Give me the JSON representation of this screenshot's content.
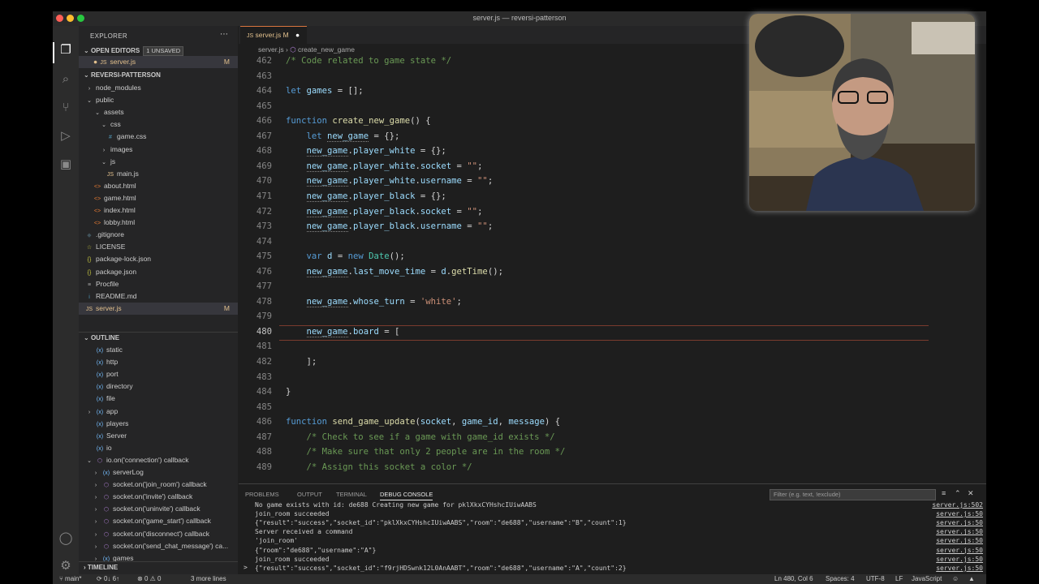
{
  "window_title": "server.js — reversi-patterson",
  "explorer": {
    "title": "EXPLORER",
    "open_editors_label": "OPEN EDITORS",
    "unsaved_badge": "1 UNSAVED",
    "open_file": "server.js",
    "open_file_status": "M",
    "project": "REVERSI-PATTERSON",
    "tree": [
      {
        "name": "node_modules",
        "type": "folder-closed"
      },
      {
        "name": "public",
        "type": "folder-open"
      },
      {
        "name": "assets",
        "type": "folder-open"
      },
      {
        "name": "css",
        "type": "folder-open"
      },
      {
        "name": "game.css",
        "type": "css"
      },
      {
        "name": "images",
        "type": "folder-closed"
      },
      {
        "name": "js",
        "type": "folder-open"
      },
      {
        "name": "main.js",
        "type": "js"
      },
      {
        "name": "about.html",
        "type": "html"
      },
      {
        "name": "game.html",
        "type": "html"
      },
      {
        "name": "index.html",
        "type": "html"
      },
      {
        "name": "lobby.html",
        "type": "html"
      },
      {
        "name": ".gitignore",
        "type": "git"
      },
      {
        "name": "LICENSE",
        "type": "license"
      },
      {
        "name": "package-lock.json",
        "type": "json"
      },
      {
        "name": "package.json",
        "type": "json"
      },
      {
        "name": "Procfile",
        "type": "file"
      },
      {
        "name": "README.md",
        "type": "md"
      },
      {
        "name": "server.js",
        "type": "js",
        "status": "M"
      }
    ]
  },
  "outline": {
    "title": "OUTLINE",
    "items": [
      "static",
      "http",
      "port",
      "directory",
      "file",
      "app",
      "players",
      "Server",
      "io",
      "io.on('connection') callback",
      "serverLog",
      "socket.on('join_room') callback",
      "socket.on('invite') callback",
      "socket.on('uninvite') callback",
      "socket.on('game_start') callback",
      "socket.on('disconnect') callback",
      "socket.on('send_chat_message') ca...",
      "games"
    ],
    "timeline_label": "TIMELINE"
  },
  "editor": {
    "tab_label": "server.js",
    "tab_status": "M",
    "breadcrumb_file": "server.js",
    "breadcrumb_symbol": "create_new_game",
    "current_line": "480",
    "lines": [
      {
        "n": "462",
        "html": "<span class='com'>/* Code related to game state */</span>"
      },
      {
        "n": "463",
        "html": ""
      },
      {
        "n": "464",
        "html": "<span class='kw'>let</span> <span class='var'>games</span> = [];"
      },
      {
        "n": "465",
        "html": ""
      },
      {
        "n": "466",
        "html": "<span class='kw'>function</span> <span class='fn'>create_new_game</span>() {"
      },
      {
        "n": "467",
        "html": "    <span class='kw'>let</span> <span class='var u'>new_game</span> = {};"
      },
      {
        "n": "468",
        "html": "    <span class='var u'>new_game</span>.<span class='var'>player_white</span> = {};"
      },
      {
        "n": "469",
        "html": "    <span class='var u'>new_game</span>.<span class='var'>player_white</span>.<span class='var'>socket</span> = <span class='str'>\"\"</span>;"
      },
      {
        "n": "470",
        "html": "    <span class='var u'>new_game</span>.<span class='var'>player_white</span>.<span class='var'>username</span> = <span class='str'>\"\"</span>;"
      },
      {
        "n": "471",
        "html": "    <span class='var u'>new_game</span>.<span class='var'>player_black</span> = {};"
      },
      {
        "n": "472",
        "html": "    <span class='var u'>new_game</span>.<span class='var'>player_black</span>.<span class='var'>socket</span> = <span class='str'>\"\"</span>;"
      },
      {
        "n": "473",
        "html": "    <span class='var u'>new_game</span>.<span class='var'>player_black</span>.<span class='var'>username</span> = <span class='str'>\"\"</span>;"
      },
      {
        "n": "474",
        "html": ""
      },
      {
        "n": "475",
        "html": "    <span class='kw'>var</span> <span class='var'>d</span> = <span class='kw'>new</span> <span class='cls'>Date</span>();"
      },
      {
        "n": "476",
        "html": "    <span class='var u'>new_game</span>.<span class='var'>last_move_time</span> = <span class='var'>d</span>.<span class='fn'>getTime</span>();"
      },
      {
        "n": "477",
        "html": ""
      },
      {
        "n": "478",
        "html": "    <span class='var u'>new_game</span>.<span class='var'>whose_turn</span> = <span class='str'>'white'</span>;"
      },
      {
        "n": "479",
        "html": ""
      },
      {
        "n": "480",
        "html": "    <span class='var u'>new_game</span>.<span class='var'>board</span> = ["
      },
      {
        "n": "481",
        "html": ""
      },
      {
        "n": "482",
        "html": "    ];"
      },
      {
        "n": "483",
        "html": ""
      },
      {
        "n": "484",
        "html": "}"
      },
      {
        "n": "485",
        "html": ""
      },
      {
        "n": "486",
        "html": "<span class='kw'>function</span> <span class='fn'>send_game_update</span>(<span class='var'>socket</span>, <span class='var'>game_id</span>, <span class='var'>message</span>) {"
      },
      {
        "n": "487",
        "html": "    <span class='com'>/* Check to see if a game with game_id exists */</span>"
      },
      {
        "n": "488",
        "html": "    <span class='com'>/* Make sure that only 2 people are in the room */</span>"
      },
      {
        "n": "489",
        "html": "    <span class='com'>/* Assign this socket a color */</span>"
      }
    ]
  },
  "panel": {
    "tabs": [
      "PROBLEMS",
      "OUTPUT",
      "TERMINAL",
      "DEBUG CONSOLE"
    ],
    "active_tab": "DEBUG CONSOLE",
    "filter_placeholder": "Filter (e.g. text, !exclude)",
    "log": [
      {
        "text": "No game exists with id: de688 Creating new game for pklXkxCYHshcIUiwAABS",
        "src": "server.js:502"
      },
      {
        "text": "join_room succeeded",
        "src": "server.js:50"
      },
      {
        "text": "{\"result\":\"success\",\"socket_id\":\"pklXkxCYHshcIUiwAABS\",\"room\":\"de688\",\"username\":\"B\",\"count\":1}",
        "src": "server.js:50"
      },
      {
        "text": "Server received a command",
        "src": "server.js:50"
      },
      {
        "text": "'join_room'",
        "src": "server.js:50"
      },
      {
        "text": "{\"room\":\"de688\",\"username\":\"A\"}",
        "src": "server.js:50"
      },
      {
        "text": "join_room succeeded",
        "src": "server.js:50"
      },
      {
        "text": "{\"result\":\"success\",\"socket_id\":\"f9rjHDSwnk12L0AnAABT\",\"room\":\"de688\",\"username\":\"A\",\"count\":2}",
        "src": "server.js:50"
      }
    ],
    "prompt": ">"
  },
  "status": {
    "branch": "main*",
    "sync": "0↓ 6↑",
    "errors": "0",
    "warnings": "0",
    "more": "3 more lines",
    "position": "Ln 480, Col 6",
    "spaces": "Spaces: 4",
    "encoding": "UTF-8",
    "eol": "LF",
    "language": "JavaScript"
  },
  "colors": {
    "accent_modified": "#e2c08d",
    "tab_border": "#d9753e",
    "status_bg": "#2c2c2c",
    "editor_bg": "#1e1e1e"
  }
}
